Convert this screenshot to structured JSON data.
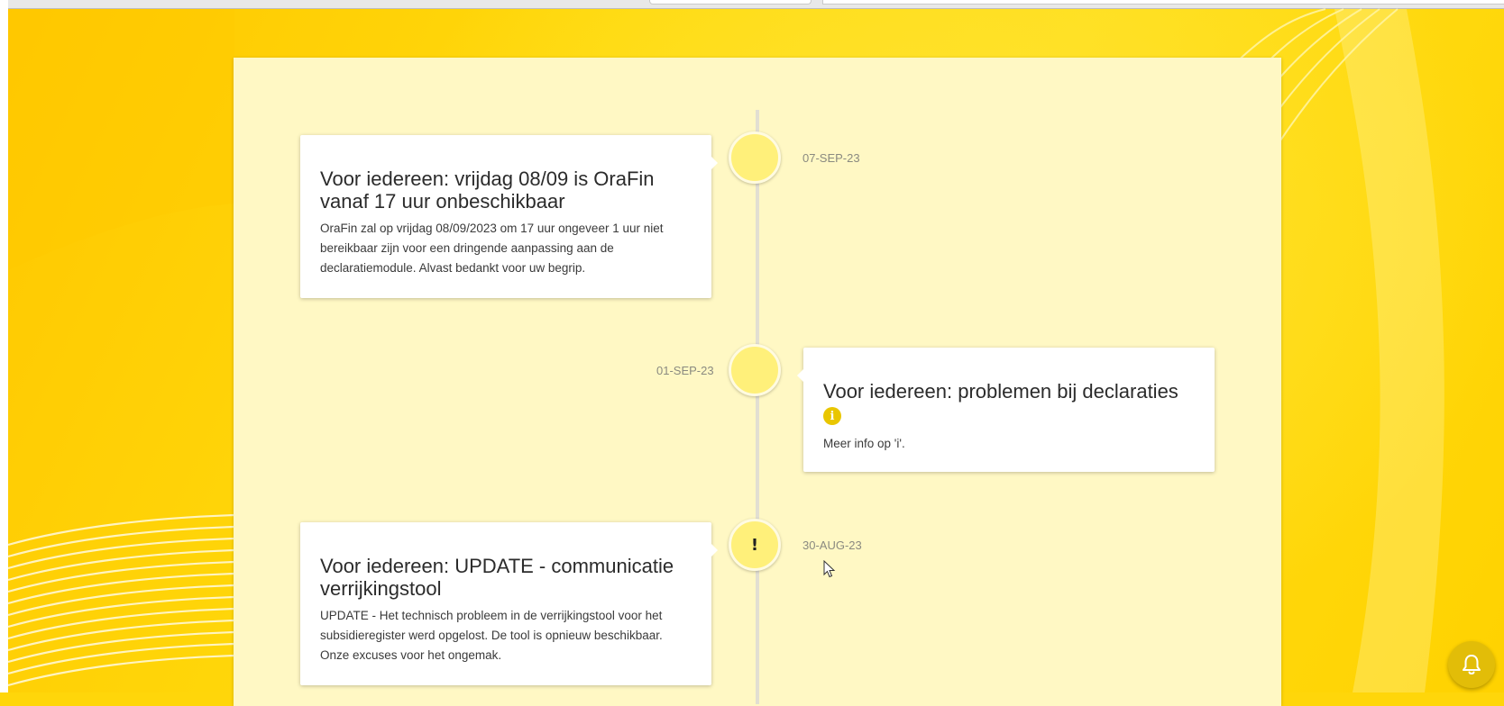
{
  "colors": {
    "background_yellow": "#ffd60a",
    "panel": "#fff8c4",
    "node": "#fff07a",
    "accent": "#e2bd08"
  },
  "timeline": [
    {
      "date": "07-SEP-23",
      "side": "left",
      "node_symbol": "",
      "title": "Voor iedereen: vrijdag 08/09 is OraFin vanaf 17 uur onbeschikbaar",
      "body": "OraFin zal op vrijdag 08/09/2023 om 17 uur ongeveer 1 uur niet bereikbaar zijn voor een dringende aanpassing aan de declaratiemodule. Alvast bedankt voor uw begrip."
    },
    {
      "date": "01-SEP-23",
      "side": "right",
      "node_symbol": "",
      "title": "Voor iedereen: problemen bij declaraties",
      "info_icon": "i",
      "body": "Meer info op 'i'."
    },
    {
      "date": "30-AUG-23",
      "side": "left",
      "node_symbol": "!",
      "title": "Voor iedereen: UPDATE - communicatie verrijkingstool",
      "body": "UPDATE - Het technisch probleem in de verrijkingstool voor het subsidieregister werd opgelost. De tool is opnieuw beschikbaar. Onze excuses voor het ongemak."
    }
  ],
  "icons": {
    "notification": "bell-icon",
    "info": "info-icon",
    "cursor": "mouse-pointer-icon"
  }
}
